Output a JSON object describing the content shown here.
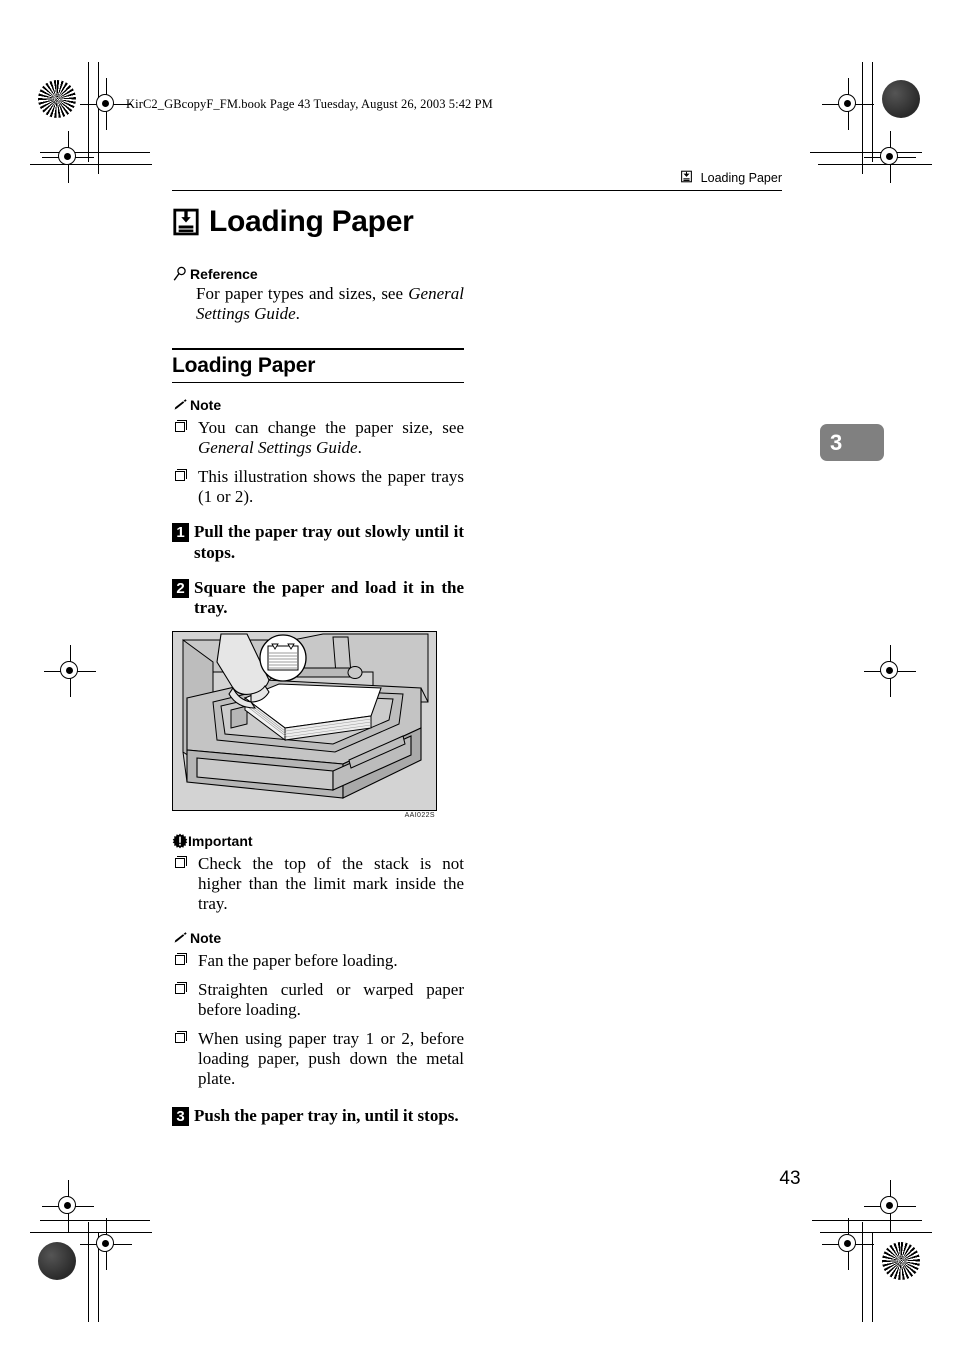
{
  "file_header": "KirC2_GBcopyF_FM.book  Page 43  Tuesday, August 26, 2003  5:42 PM",
  "running_header": {
    "icon": "paper-tray-icon",
    "text": "Loading Paper"
  },
  "chapter_title": {
    "icon": "paper-tray-load-icon",
    "text": "Loading Paper"
  },
  "reference_block": {
    "icon": "magnifier-icon",
    "heading": "Reference",
    "text_before": "For paper types and sizes, see ",
    "text_italic": "General Settings Guide",
    "text_after": "."
  },
  "section_title": "Loading Paper",
  "note_block_1": {
    "icon": "pencil-icon",
    "heading": "Note",
    "items": [
      {
        "text_before": "You can change the paper size, see ",
        "text_italic": "General Settings Guide",
        "text_after": "."
      },
      {
        "text_before": "This illustration shows the paper trays (1 or 2).",
        "text_italic": "",
        "text_after": ""
      }
    ]
  },
  "steps": [
    {
      "number": "1",
      "text": "Pull the paper tray out slowly until it stops."
    },
    {
      "number": "2",
      "text": "Square the paper and load it in the tray."
    },
    {
      "number": "3",
      "text": "Push the paper tray in, until it stops."
    }
  ],
  "figure": {
    "alt": "Paper tray pulled out of copier with hand loading a stack of paper, inset circle showing limit mark",
    "caption_id": "AAI022S"
  },
  "important_block": {
    "icon": "important-burst-icon",
    "heading": "Important",
    "items": [
      "Check the top of the stack is not higher than the limit mark inside the tray."
    ]
  },
  "note_block_2": {
    "icon": "pencil-icon",
    "heading": "Note",
    "items": [
      "Fan the paper before loading.",
      "Straighten curled or warped paper before loading.",
      "When using paper tray 1 or 2, before loading paper, push down the metal plate."
    ]
  },
  "chapter_tab": "3",
  "page_number": "43",
  "colors": {
    "chapter_tab_bg": "#808080",
    "illustration_bg": "#d0d0d0",
    "text": "#000000"
  }
}
